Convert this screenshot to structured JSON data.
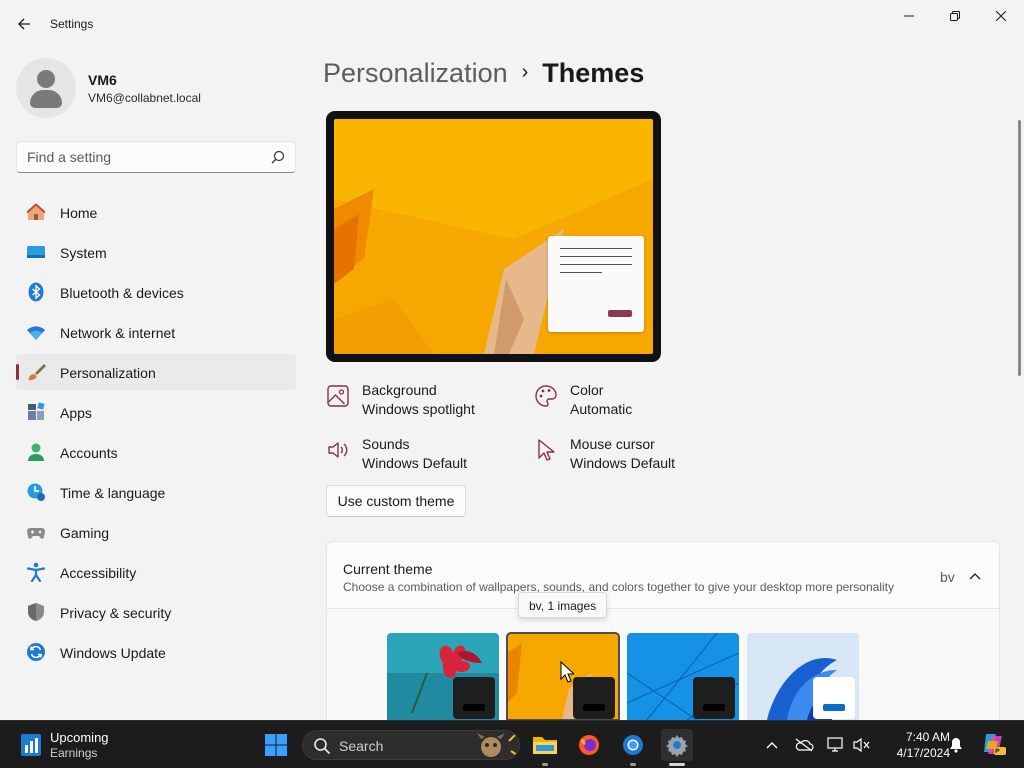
{
  "window": {
    "title": "Settings"
  },
  "user": {
    "name": "VM6",
    "email": "VM6@collabnet.local"
  },
  "search": {
    "placeholder": "Find a setting"
  },
  "sidebar": {
    "items": [
      {
        "label": "Home",
        "icon": "home-icon"
      },
      {
        "label": "System",
        "icon": "system-icon"
      },
      {
        "label": "Bluetooth & devices",
        "icon": "bluetooth-icon"
      },
      {
        "label": "Network & internet",
        "icon": "network-icon"
      },
      {
        "label": "Personalization",
        "icon": "brush-icon",
        "active": true
      },
      {
        "label": "Apps",
        "icon": "apps-icon"
      },
      {
        "label": "Accounts",
        "icon": "accounts-icon"
      },
      {
        "label": "Time & language",
        "icon": "time-language-icon"
      },
      {
        "label": "Gaming",
        "icon": "gaming-icon"
      },
      {
        "label": "Accessibility",
        "icon": "accessibility-icon"
      },
      {
        "label": "Privacy & security",
        "icon": "shield-icon"
      },
      {
        "label": "Windows Update",
        "icon": "update-icon"
      }
    ]
  },
  "breadcrumb": {
    "parent": "Personalization",
    "separator": "›",
    "current": "Themes"
  },
  "theme_props": {
    "background": {
      "label": "Background",
      "value": "Windows spotlight"
    },
    "color": {
      "label": "Color",
      "value": "Automatic"
    },
    "sounds": {
      "label": "Sounds",
      "value": "Windows Default"
    },
    "cursor": {
      "label": "Mouse cursor",
      "value": "Windows Default"
    }
  },
  "buttons": {
    "custom_theme": "Use custom theme"
  },
  "current_theme": {
    "title": "Current theme",
    "subtitle": "Choose a combination of wallpapers, sounds, and colors together to give your desktop more personality",
    "value": "bv",
    "tooltip": "bv, 1 images"
  },
  "taskbar": {
    "widget_title": "Upcoming",
    "widget_subtitle": "Earnings",
    "search_label": "Search",
    "time": "7:40 AM",
    "date": "4/17/2024"
  },
  "colors": {
    "accent": "#8a2f46",
    "taskbar": "#1c1c1c"
  }
}
